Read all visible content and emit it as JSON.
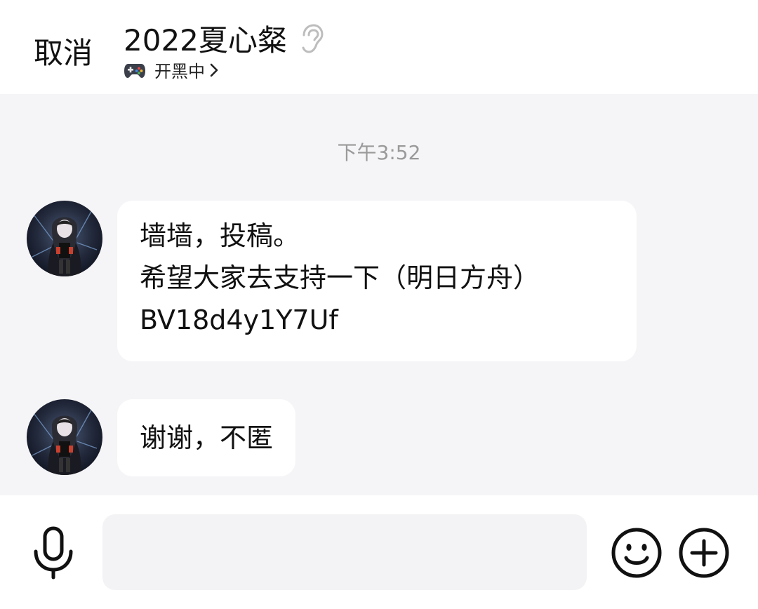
{
  "header": {
    "cancel_label": "取消",
    "title": "2022夏心粲",
    "status_icon": "gamepad-icon",
    "status_text": "开黑中"
  },
  "chat": {
    "timestamp": "下午3:52",
    "messages": [
      {
        "lines": [
          "墙墙，投稿。",
          "希望大家去支持一下（明日方舟）",
          "BV18d4y1Y7Uf"
        ]
      },
      {
        "lines": [
          "谢谢，不匿"
        ]
      }
    ]
  },
  "input": {
    "placeholder": "",
    "value": ""
  },
  "colors": {
    "background": "#f5f4f6",
    "bubble": "#ffffff",
    "timestamp": "#9a9a9a"
  }
}
